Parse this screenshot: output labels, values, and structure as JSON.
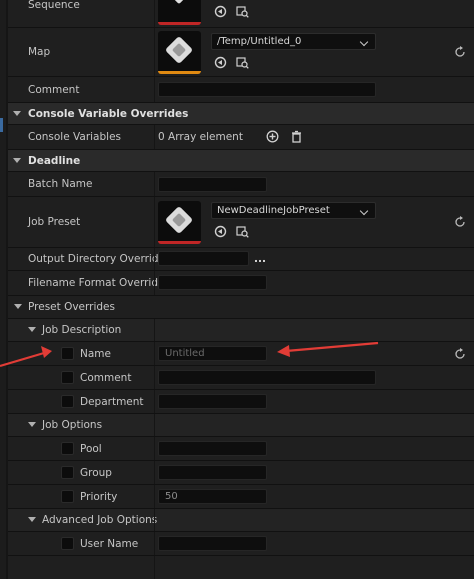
{
  "properties": {
    "sequence": {
      "label": "Sequence"
    },
    "map": {
      "label": "Map",
      "value": "/Temp/Untitled_0"
    },
    "comment": {
      "label": "Comment",
      "value": ""
    }
  },
  "console_variable_overrides": {
    "title": "Console Variable Overrides",
    "console_variables": {
      "label": "Console Variables",
      "value": "0 Array element"
    }
  },
  "deadline": {
    "title": "Deadline",
    "batch_name": {
      "label": "Batch Name",
      "value": ""
    },
    "job_preset": {
      "label": "Job Preset",
      "value": "NewDeadlineJobPreset"
    },
    "output_directory_override": {
      "label": "Output Directory Override",
      "value": "",
      "browse": "..."
    },
    "filename_format_override": {
      "label": "Filename Format Override",
      "value": ""
    },
    "preset_overrides": {
      "title": "Preset Overrides",
      "job_description": {
        "title": "Job Description",
        "name": {
          "label": "Name",
          "value": "Untitled"
        },
        "comment": {
          "label": "Comment",
          "value": ""
        },
        "department": {
          "label": "Department",
          "value": ""
        }
      },
      "job_options": {
        "title": "Job Options",
        "pool": {
          "label": "Pool",
          "value": ""
        },
        "group": {
          "label": "Group",
          "value": ""
        },
        "priority": {
          "label": "Priority",
          "value": "50"
        }
      },
      "advanced_job_options": {
        "title": "Advanced Job Options",
        "user_name": {
          "label": "User Name",
          "value": ""
        }
      }
    }
  },
  "colors": {
    "accent_red": "#e23c36",
    "thumb_red": "#c02626",
    "thumb_orange": "#e08a12"
  }
}
